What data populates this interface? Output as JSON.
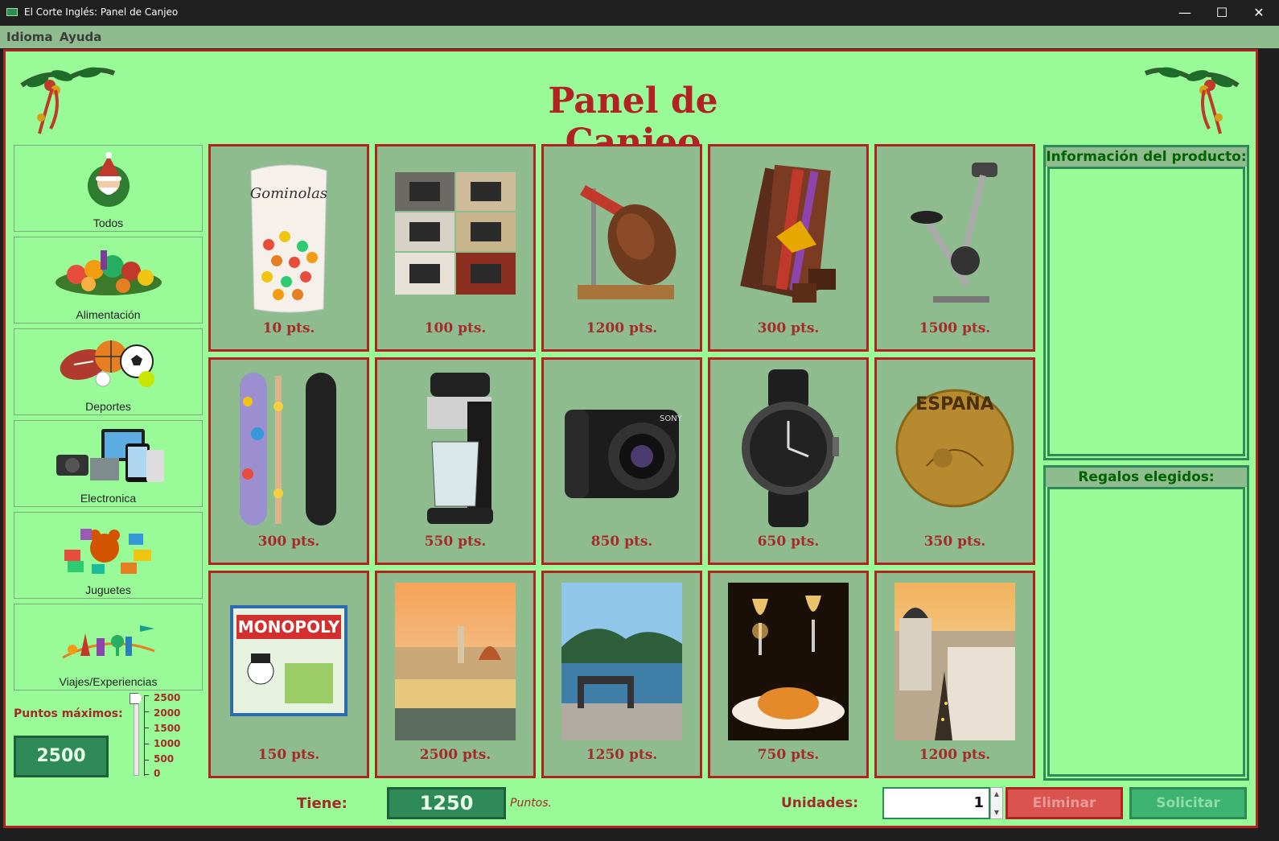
{
  "window": {
    "title": "El Corte Inglés: Panel de Canjeo",
    "min": "—",
    "max": "☐",
    "close": "✕"
  },
  "menu": {
    "idioma": "Idioma",
    "ayuda": "Ayuda"
  },
  "header": {
    "title": "Panel de Canjeo"
  },
  "categories": [
    {
      "label": "Todos",
      "icon": "santa-icon"
    },
    {
      "label": "Alimentación",
      "icon": "food-icon"
    },
    {
      "label": "Deportes",
      "icon": "sports-balls-icon"
    },
    {
      "label": "Electronica",
      "icon": "electronics-icon"
    },
    {
      "label": "Juguetes",
      "icon": "toys-icon"
    },
    {
      "label": "Viajes/Experiencias",
      "icon": "travel-icon"
    }
  ],
  "products": [
    {
      "price": "10 pts.",
      "icon": "gummy-candy-bag-image"
    },
    {
      "price": "100 pts.",
      "icon": "turron-boxes-image"
    },
    {
      "price": "1200 pts.",
      "icon": "jamon-ham-stand-image"
    },
    {
      "price": "300 pts.",
      "icon": "godiva-chocolate-image"
    },
    {
      "price": "1500 pts.",
      "icon": "exercise-bike-image"
    },
    {
      "price": "300 pts.",
      "icon": "skateboard-image"
    },
    {
      "price": "550 pts.",
      "icon": "coffee-maker-image"
    },
    {
      "price": "850 pts.",
      "icon": "sony-camera-image"
    },
    {
      "price": "650 pts.",
      "icon": "smartwatch-image"
    },
    {
      "price": "350 pts.",
      "icon": "spain-football-image"
    },
    {
      "price": "150 pts.",
      "icon": "monopoly-box-image"
    },
    {
      "price": "2500 pts.",
      "icon": "florence-city-image"
    },
    {
      "price": "1250 pts.",
      "icon": "coastal-bench-view-image"
    },
    {
      "price": "750 pts.",
      "icon": "dinner-wine-image"
    },
    {
      "price": "1200 pts.",
      "icon": "madrid-gran-via-image"
    }
  ],
  "sidebar": {
    "info_title": "Información del producto:",
    "gifts_title": "Regalos elegidos:"
  },
  "points": {
    "max_label": "Puntos máximos:",
    "max_value": "2500",
    "slider_value": 2500,
    "ticks": [
      "2500",
      "2000",
      "1500",
      "1000",
      "500",
      "0"
    ]
  },
  "footer": {
    "tiene_label": "Tiene:",
    "tiene_value": "1250",
    "puntos_label": "Puntos.",
    "unidades_label": "Unidades:",
    "unidades_value": "1",
    "eliminar": "Eliminar",
    "solicitar": "Solicitar"
  },
  "colors": {
    "background": "#98fb98",
    "tile": "#8fbc8f",
    "accent_red": "#b22222",
    "accent_green": "#2e8b57"
  }
}
